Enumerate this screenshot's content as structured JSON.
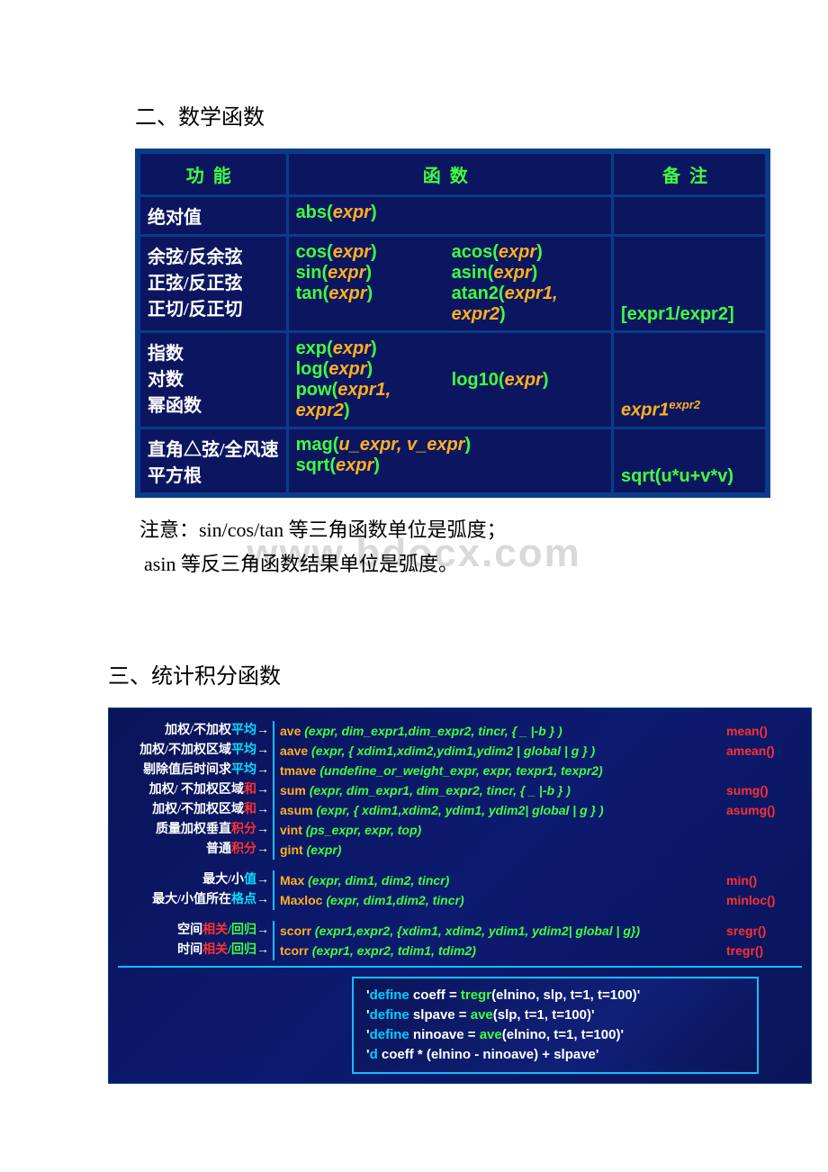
{
  "sections": {
    "section2_title": "二、数学函数",
    "section3_title": "三、统计积分函数"
  },
  "watermark": "www.bdocx.com",
  "table1": {
    "headers": [
      "功能",
      "函数",
      "备注"
    ],
    "rows": [
      {
        "label": "绝对值",
        "col1": [
          {
            "fn": "abs",
            "args": "expr"
          }
        ],
        "col2": [],
        "note": ""
      },
      {
        "label_lines": [
          "余弦/反余弦",
          "正弦/反正弦",
          "正切/反正切"
        ],
        "col1": [
          {
            "fn": "cos",
            "args": "expr"
          },
          {
            "fn": "sin",
            "args": "expr"
          },
          {
            "fn": "tan",
            "args": "expr"
          }
        ],
        "col2": [
          {
            "fn": "acos",
            "args": "expr"
          },
          {
            "fn": "asin",
            "args": "expr"
          },
          {
            "fn": "atan2",
            "args": "expr1, expr2"
          }
        ],
        "note_plain": "[expr1/expr2]"
      },
      {
        "label_lines": [
          "指数",
          "对数",
          "幂函数"
        ],
        "col1": [
          {
            "fn": "exp",
            "args": "expr"
          },
          {
            "fn": "log",
            "args": "expr"
          },
          {
            "fn": "pow",
            "args": "expr1, expr2"
          }
        ],
        "col2": [
          {
            "txt": "",
            "fn": "",
            "args": ""
          },
          {
            "fn": "log10",
            "args": "expr"
          },
          {
            "txt": ""
          }
        ],
        "note_html": {
          "base": "expr1",
          "exp": "expr2"
        }
      },
      {
        "label_lines": [
          "直角△弦/全风速",
          "平方根"
        ],
        "col1": [
          {
            "fn": "mag",
            "args": "u_expr, v_expr"
          },
          {
            "fn": "sqrt",
            "args": "expr"
          }
        ],
        "col2": [],
        "note_plain": "sqrt(u*u+v*v)"
      }
    ]
  },
  "notes": {
    "n1": "注意：sin/cos/tan 等三角函数单位是弧度；",
    "n2": "asin 等反三角函数结果单位是弧度。"
  },
  "stats": {
    "group1": [
      {
        "left_pre": "加权/不加权",
        "left_hl": "平均",
        "left_color": "cyan",
        "fname": "ave",
        "args": "(expr, dim_expr1,dim_expr2, tincr, { _ |-b } )",
        "right": "mean()"
      },
      {
        "left_pre": "加权/不加权区域",
        "left_hl": "平均",
        "left_color": "cyan",
        "fname": "aave",
        "args": "(expr, { xdim1,xdim2,ydim1,ydim2 | global | g } )",
        "right": "amean()"
      },
      {
        "left_pre": "剔除值后时间求",
        "left_hl": "平均",
        "left_color": "cyan",
        "fname": "tmave",
        "args": "(undefine_or_weight_expr, expr, texpr1, texpr2)",
        "right": ""
      },
      {
        "left_pre": "加权/ 不加权区域",
        "left_hl": "和",
        "left_color": "red",
        "fname": "sum",
        "args": "(expr, dim_expr1, dim_expr2, tincr, { _ |-b } )",
        "right": "sumg()"
      },
      {
        "left_pre": "加权/不加权区域",
        "left_hl": "和",
        "left_color": "red",
        "fname": "asum",
        "args": "(expr, { xdim1,xdim2, ydim1, ydim2| global | g } )",
        "right": "asumg()"
      },
      {
        "left_pre": "质量加权垂直",
        "left_hl": "积分",
        "left_color": "red",
        "fname": "vint",
        "args": "(ps_expr, expr, top)",
        "right": ""
      },
      {
        "left_pre": "普通",
        "left_hl": "积分",
        "left_color": "red",
        "fname": "gint",
        "args": "(expr)",
        "right": ""
      }
    ],
    "group2": [
      {
        "left_pre": "最大/小",
        "left_hl": "值",
        "left_color": "cyan",
        "fname": "Max",
        "args": "(expr, dim1, dim2, tincr)",
        "right": "min()"
      },
      {
        "left_pre": "最大/小值所在",
        "left_hl": "格点",
        "left_color": "cyan",
        "fname": "Maxloc",
        "args": "(expr, dim1,dim2, tincr)",
        "right": "minloc()"
      }
    ],
    "group3": [
      {
        "left_pre": "空间",
        "left_mid": "相关",
        "left_hl": "/回归",
        "left_color": "green",
        "mid_color": "red",
        "fname": "scorr",
        "args": "(expr1,expr2, {xdim1, xdim2, ydim1, ydim2| global | g})",
        "right": "sregr()"
      },
      {
        "left_pre": "时间",
        "left_mid": "相关",
        "left_hl": "/回归",
        "left_color": "green",
        "mid_color": "red",
        "fname": "tcorr",
        "args": "(expr1, expr2, tdim1, tdim2)",
        "right": "tregr()"
      }
    ],
    "example": [
      {
        "pre": "'",
        "kw": "define",
        "txt1": " coeff = ",
        "fn": "tregr",
        "txt2": "(elnino, slp, t=1, t=100)'"
      },
      {
        "pre": "'",
        "kw": "define",
        "txt1": " slpave = ",
        "fn": "ave",
        "txt2": "(slp, t=1, t=100)'"
      },
      {
        "pre": "'",
        "kw": "define",
        "txt1": " ninoave = ",
        "fn": "ave",
        "txt2": "(elnino, t=1, t=100)'"
      },
      {
        "pre": "'",
        "kw": "d",
        "txt1": " coeff * (elnino - ninoave) + slpave'",
        "fn": "",
        "txt2": ""
      }
    ]
  }
}
